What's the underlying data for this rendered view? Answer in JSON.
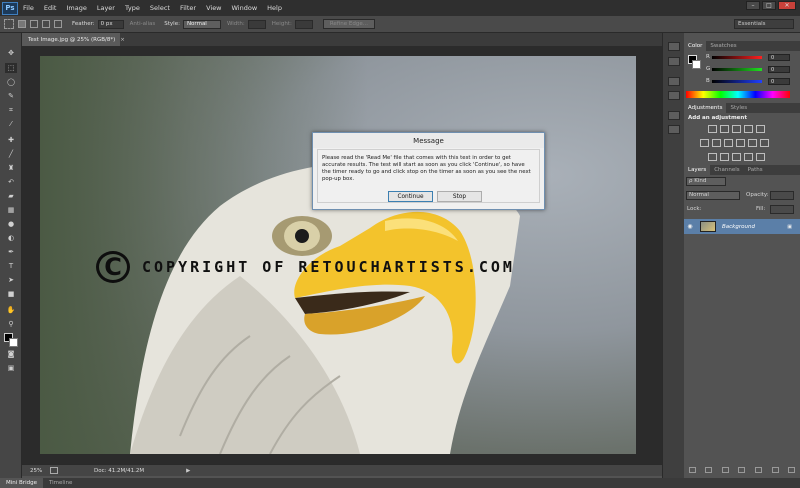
{
  "app": {
    "logo": "Ps"
  },
  "menu": [
    "File",
    "Edit",
    "Image",
    "Layer",
    "Type",
    "Select",
    "Filter",
    "View",
    "Window",
    "Help"
  ],
  "window_controls": {
    "minimize": "–",
    "maximize": "□",
    "close": "✕"
  },
  "options": {
    "feather_label": "Feather:",
    "feather_value": "0 px",
    "antialias_label": "Anti-alias",
    "style_label": "Style:",
    "style_value": "Normal",
    "width_label": "Width:",
    "height_label": "Height:",
    "refine_edge": "Refine Edge...",
    "workspace": "Essentials"
  },
  "document": {
    "tab_title": "Test Image.jpg @ 25% (RGB/8*)",
    "close": "×",
    "watermark": {
      "symbol": "C",
      "text": "COPYRIGHT OF RETOUCHARTISTS.COM"
    }
  },
  "status": {
    "zoom": "25%",
    "doc_info": "Doc: 41.2M/41.2M",
    "arrow": "▶"
  },
  "bottom_tabs": [
    "Mini Bridge",
    "Timeline"
  ],
  "panels": {
    "color_tabs": [
      "Color",
      "Swatches"
    ],
    "color_sliders": [
      {
        "letter": "R",
        "value": "0",
        "color": "#e03030"
      },
      {
        "letter": "G",
        "value": "0",
        "color": "#30c030"
      },
      {
        "letter": "B",
        "value": "0",
        "color": "#3050e0"
      }
    ],
    "adjustments_tabs": [
      "Adjustments",
      "Styles"
    ],
    "adjustments_title": "Add an adjustment",
    "layers_tabs": [
      "Layers",
      "Channels",
      "Paths"
    ],
    "layers_kind": "ρ Kind",
    "blend_mode": "Normal",
    "opacity_label": "Opacity:",
    "lock_label": "Lock:",
    "fill_label": "Fill:",
    "layer_name": "Background"
  },
  "dialog": {
    "title": "Message",
    "message": "Please read the 'Read Me' file that comes with this test in order to get accurate results. The test will start as soon as you click 'Continue', so have the timer ready to go and click stop on the timer as soon as you see the next pop-up box.",
    "continue_label": "Continue",
    "stop_label": "Stop"
  }
}
